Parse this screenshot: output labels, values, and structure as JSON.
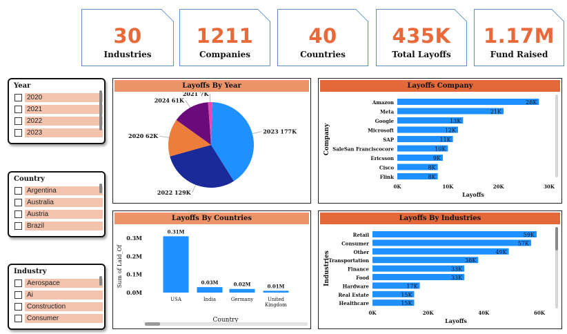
{
  "kpis": [
    {
      "value": "30",
      "label": "Industries"
    },
    {
      "value": "1211",
      "label": "Companies"
    },
    {
      "value": "40",
      "label": "Countries"
    },
    {
      "value": "435K",
      "label": "Total Layoffs"
    },
    {
      "value": "1.17M",
      "label": "Fund Raised"
    }
  ],
  "slicers": {
    "year": {
      "title": "Year",
      "items": [
        "2020",
        "2021",
        "2022",
        "2023"
      ]
    },
    "country": {
      "title": "Country",
      "items": [
        "Argentina",
        "Australia",
        "Austria",
        "Brazil"
      ]
    },
    "industry": {
      "title": "Industry",
      "items": [
        "Aerospace",
        "Ai",
        "Construction",
        "Consumer"
      ]
    }
  },
  "panels": {
    "by_year": "Layoffs By Year",
    "company": "Layoffs Company",
    "countries": "Layoffs By Countries",
    "industries": "Layoffs By Industries"
  },
  "colors": {
    "accent": "#e8693a",
    "bar": "#1e90ff",
    "title_light": "#ec936a",
    "title_dark": "#e3683a"
  },
  "chart_data": [
    {
      "type": "pie",
      "title": "Layoffs By Year",
      "slices": [
        {
          "label": "2023 177K",
          "value": 177,
          "color": "#1e90ff"
        },
        {
          "label": "2022 129K",
          "value": 129,
          "color": "#1a2a99"
        },
        {
          "label": "2020 62K",
          "value": 62,
          "color": "#ed7d3a"
        },
        {
          "label": "2024 61K",
          "value": 61,
          "color": "#6b0a7a"
        },
        {
          "label": "2021 7K",
          "value": 7,
          "color": "#e14ab1"
        }
      ]
    },
    {
      "type": "bar",
      "orientation": "horizontal",
      "title": "Layoffs Company",
      "xlabel": "Layoffs",
      "ylabel": "Company",
      "categories": [
        "Amazon",
        "Meta",
        "Google",
        "Microsoft",
        "SAP",
        "SaleSan Franciscocore",
        "Ericsson",
        "Cisco",
        "Flink"
      ],
      "values": [
        28,
        21,
        13,
        12,
        11,
        10,
        9,
        8,
        8
      ],
      "data_labels": [
        "28K",
        "21K",
        "13K",
        "12K",
        "11K",
        "10K",
        "9K",
        "8K",
        "8K"
      ],
      "xticks": [
        "0K",
        "10K",
        "20K",
        "30K"
      ],
      "xlim": [
        0,
        30
      ]
    },
    {
      "type": "bar",
      "title": "Layoffs By Countries",
      "xlabel": "Country",
      "ylabel": "Sum of Laid_Of",
      "categories": [
        "USA",
        "India",
        "Germany",
        "United Kingdom"
      ],
      "values": [
        0.31,
        0.03,
        0.02,
        0.01
      ],
      "data_labels": [
        "0.31M",
        "0.03M",
        "0.02M",
        "0.01M"
      ],
      "yticks": [
        "0.0M",
        "0.1M",
        "0.2M",
        "0.3M"
      ],
      "ylim": [
        0,
        0.3
      ]
    },
    {
      "type": "bar",
      "orientation": "horizontal",
      "title": "Layoffs By Industries",
      "xlabel": "Layoffs",
      "ylabel": "Industries",
      "categories": [
        "Retail",
        "Consumer",
        "Other",
        "Transportation",
        "Finance",
        "Food",
        "Hardware",
        "Real Estate",
        "Healthcare"
      ],
      "values": [
        59,
        57,
        49,
        38,
        33,
        33,
        17,
        15,
        15
      ],
      "data_labels": [
        "59K",
        "57K",
        "49K",
        "38K",
        "33K",
        "33K",
        "17K",
        "15K",
        "15K"
      ],
      "xticks": [
        "0K",
        "20K",
        "40K",
        "60K"
      ],
      "xlim": [
        0,
        60
      ]
    }
  ]
}
